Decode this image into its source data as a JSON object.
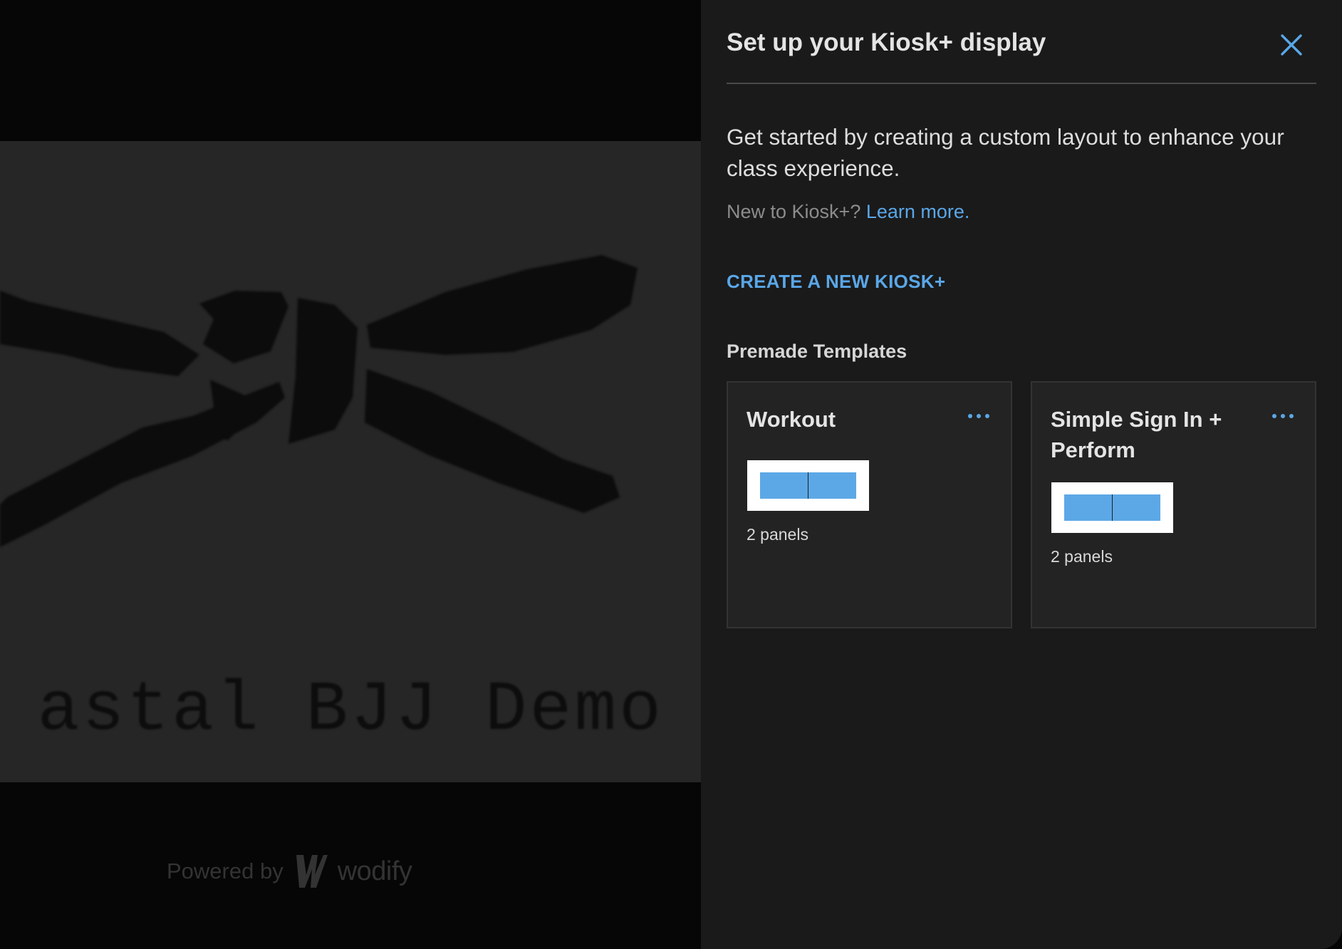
{
  "background": {
    "banner_title": "astal BJJ Demo",
    "footer": {
      "powered_by": "Powered by",
      "brand": "wodify"
    }
  },
  "drawer": {
    "title": "Set up your Kiosk+ display",
    "close_icon": "close-icon",
    "intro": "Get started by creating a custom layout to enhance your class experience.",
    "new_to_prefix": "New to Kiosk+?",
    "learn_more": "Learn more.",
    "create_label": "CREATE A NEW KIOSK+",
    "templates_heading": "Premade Templates",
    "templates": [
      {
        "name": "Workout",
        "panels_label": "2 panels",
        "menu_icon": "more-horizontal-icon"
      },
      {
        "name": "Simple Sign In + Perform",
        "panels_label": "2 panels",
        "menu_icon": "more-horizontal-icon"
      }
    ]
  },
  "colors": {
    "accent": "#5aa7e8",
    "drawer_bg": "#1a1a1a",
    "card_bg": "#232323",
    "thumb_pane": "#5ca8e6"
  }
}
